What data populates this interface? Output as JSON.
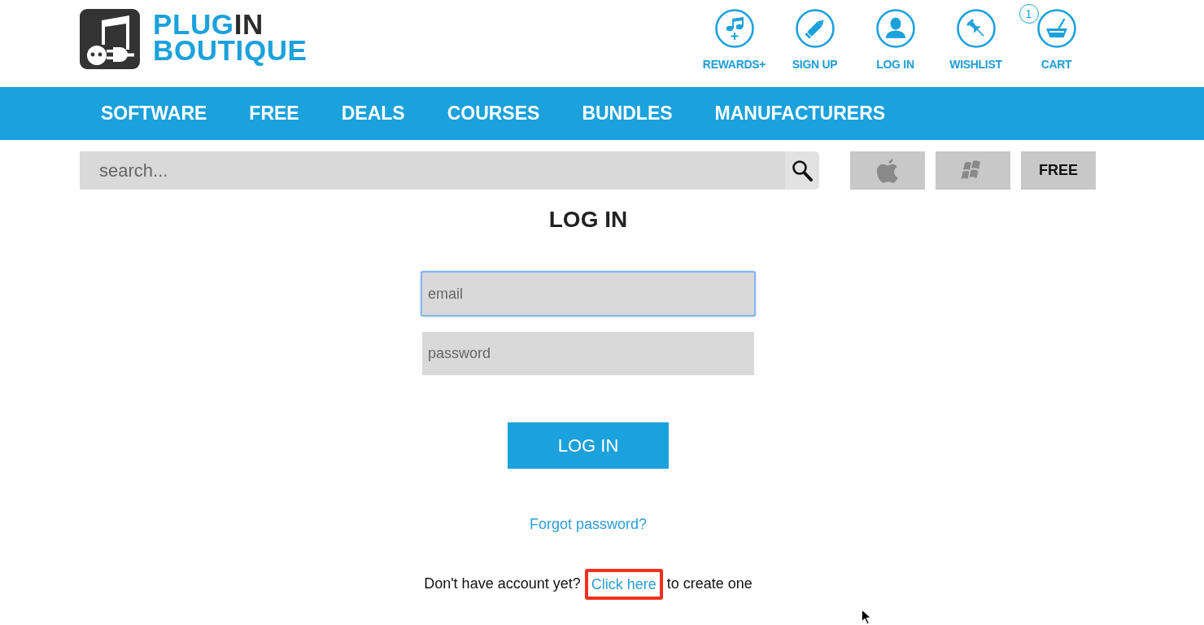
{
  "logo": {
    "wordmark": [
      [
        {
          "text": "PLUG",
          "dark": false
        },
        {
          "text": "IN",
          "dark": true
        }
      ],
      [
        {
          "text": "BOUTIQUE",
          "dark": false
        }
      ]
    ]
  },
  "header_links": [
    {
      "label": "REWARDS+",
      "kind": "rewards"
    },
    {
      "label": "SIGN UP",
      "kind": "signup"
    },
    {
      "label": "LOG IN",
      "kind": "login"
    },
    {
      "label": "WISHLIST",
      "kind": "wishlist"
    },
    {
      "label": "CART",
      "kind": "cart",
      "badge": "1"
    }
  ],
  "main_nav": [
    "SOFTWARE",
    "FREE",
    "DEALS",
    "COURSES",
    "BUNDLES",
    "MANUFACTURERS"
  ],
  "search": {
    "placeholder": "search..."
  },
  "platform_filters": [
    {
      "kind": "apple"
    },
    {
      "kind": "windows"
    },
    {
      "kind": "text",
      "label": "FREE"
    }
  ],
  "login": {
    "title": "LOG IN",
    "fields": [
      {
        "placeholder": "email",
        "focused": true
      },
      {
        "placeholder": "password",
        "focused": false
      }
    ],
    "submit": "LOG IN",
    "forgot_link": "Forgot password?",
    "signup_prompt": {
      "before": "Don't have account yet?",
      "link": "Click here",
      "after": "to create one",
      "link_highlighted": true
    }
  }
}
